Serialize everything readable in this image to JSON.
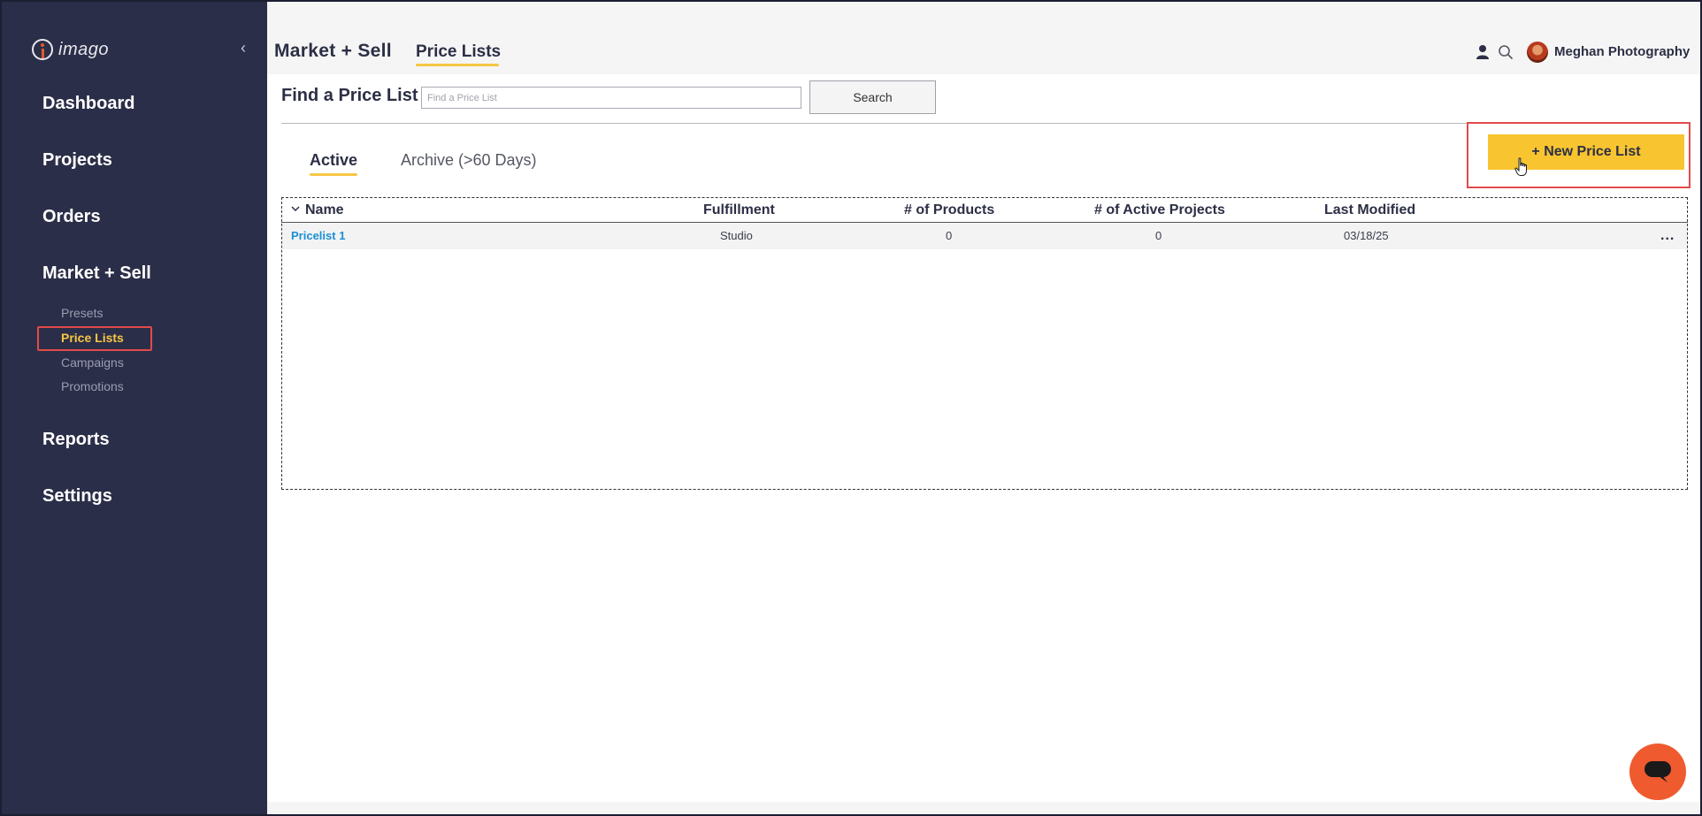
{
  "app": {
    "logo_text": "imago"
  },
  "sidebar": {
    "items": [
      {
        "label": "Dashboard"
      },
      {
        "label": "Projects"
      },
      {
        "label": "Orders"
      },
      {
        "label": "Market + Sell"
      },
      {
        "label": "Reports"
      },
      {
        "label": "Settings"
      }
    ],
    "sub_items": [
      {
        "label": "Presets"
      },
      {
        "label": "Price Lists",
        "active": true
      },
      {
        "label": "Campaigns"
      },
      {
        "label": "Promotions"
      }
    ]
  },
  "header": {
    "breadcrumb_main": "Market + Sell",
    "breadcrumb_sub": "Price Lists",
    "user_name": "Meghan Photography"
  },
  "find": {
    "label": "Find a Price List",
    "placeholder": "Find a Price List",
    "value": "",
    "search_label": "Search"
  },
  "tabs": [
    {
      "label": "Active",
      "active": true
    },
    {
      "label": "Archive (>60 Days)",
      "active": false
    }
  ],
  "new_button_label": "+ New Price List",
  "table": {
    "columns": [
      "Name",
      "Fulfillment",
      "# of Products",
      "# of Active Projects",
      "Last Modified"
    ],
    "rows": [
      {
        "name": "Pricelist 1",
        "fulfillment": "Studio",
        "products": "0",
        "active_projects": "0",
        "last_modified": "03/18/25",
        "more": "..."
      }
    ]
  },
  "colors": {
    "sidebar_bg": "#2b2e48",
    "accent_yellow": "#f8c530",
    "highlight_red": "#e24a4a",
    "link_blue": "#1a8fd6",
    "chat_orange": "#ef5a2f"
  },
  "icons": [
    "user-icon",
    "search-icon",
    "chevron-left-icon",
    "sort-chevron-icon",
    "chat-icon",
    "hand-cursor-icon"
  ]
}
